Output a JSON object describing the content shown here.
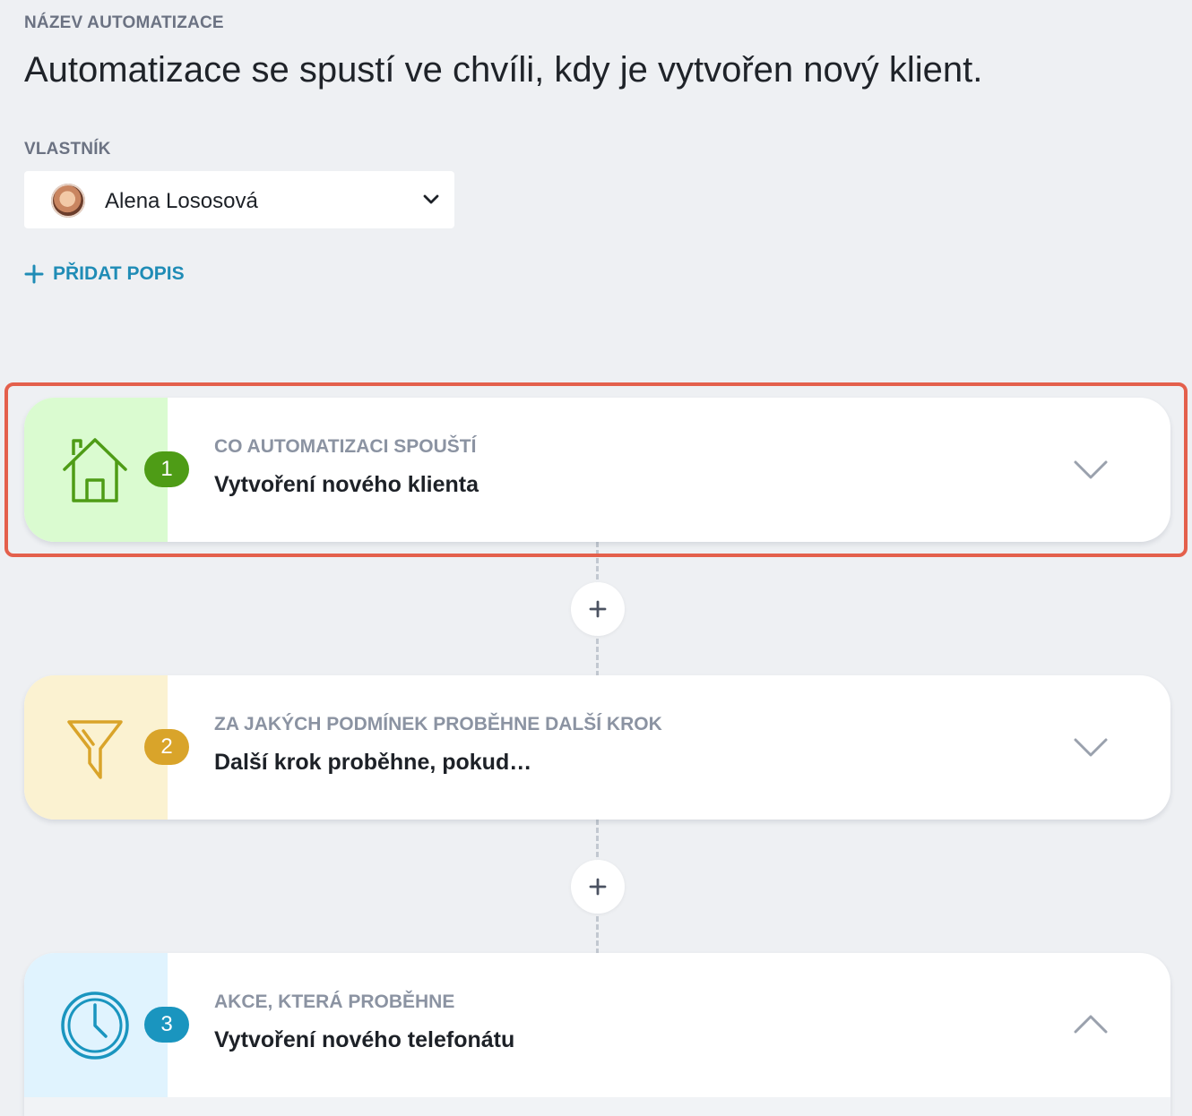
{
  "header": {
    "name_label": "NÁZEV AUTOMATIZACE",
    "name_value": "Automatizace se spustí ve chvíli, kdy je vytvořen nový klient.",
    "owner_label": "VLASTNÍK",
    "owner_name": "Alena Lososová",
    "add_description": "PŘIDAT POPIS"
  },
  "steps": [
    {
      "number": "1",
      "caption": "CO AUTOMATIZACI SPOUŠTÍ",
      "title": "Vytvoření nového klienta",
      "icon": "house-icon",
      "state": "collapsed",
      "color": "#4e9c16"
    },
    {
      "number": "2",
      "caption": "ZA JAKÝCH PODMÍNEK PROBĚHNE DALŠÍ KROK",
      "title": "Další krok proběhne, pokud…",
      "icon": "funnel-icon",
      "state": "collapsed",
      "color": "#d9a42a"
    },
    {
      "number": "3",
      "caption": "AKCE, KTERÁ PROBĚHNE",
      "title": "Vytvoření nového telefonátu",
      "icon": "clock-icon",
      "state": "expanded",
      "color": "#1a95bf"
    }
  ],
  "highlight_color": "#e4604c"
}
